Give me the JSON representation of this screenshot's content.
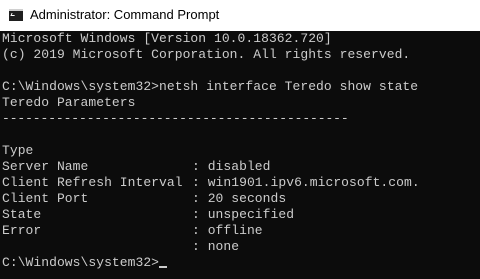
{
  "window": {
    "title": "Administrator: Command Prompt",
    "icon": "cmd-icon"
  },
  "console": {
    "banner_line1": "Microsoft Windows [Version 10.0.18362.720]",
    "banner_line2": "(c) 2019 Microsoft Corporation. All rights reserved.",
    "command_line": "C:\\Windows\\system32>netsh interface Teredo show state",
    "section_title": "Teredo Parameters",
    "separator": "---------------------------------------------",
    "params": [
      {
        "label": "Type",
        "value": ": disabled"
      },
      {
        "label": "Server Name",
        "value": ": win1901.ipv6.microsoft.com."
      },
      {
        "label": "Client Refresh Interval",
        "value": ": 20 seconds"
      },
      {
        "label": "Client Port",
        "value": ": unspecified"
      },
      {
        "label": "State",
        "value": ": offline"
      },
      {
        "label": "Error",
        "value": ": none"
      }
    ],
    "prompt": "C:\\Windows\\system32>"
  }
}
